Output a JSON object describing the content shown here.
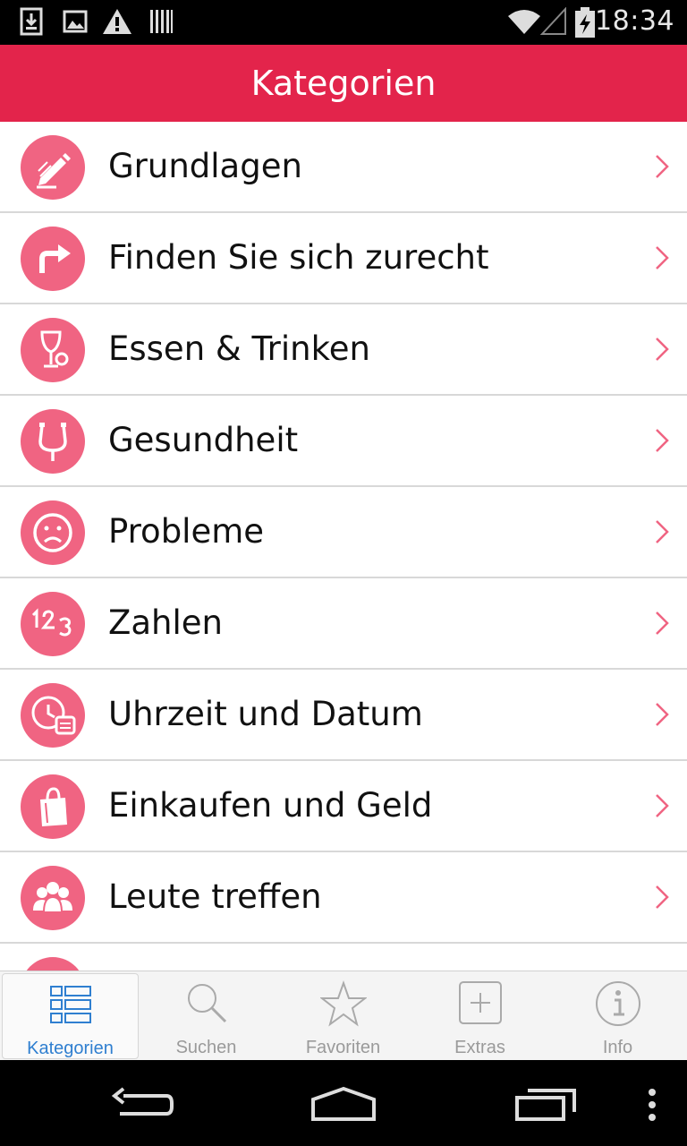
{
  "status_bar": {
    "time": "18:34",
    "icons": [
      "download-icon",
      "image-icon",
      "warning-icon",
      "barcode-icon",
      "wifi-icon",
      "signal-icon",
      "battery-charging-icon"
    ]
  },
  "header": {
    "title": "Kategorien"
  },
  "categories": [
    {
      "label": "Grundlagen",
      "icon": "pencil-icon"
    },
    {
      "label": "Finden Sie sich zurecht",
      "icon": "turn-right-arrow-icon"
    },
    {
      "label": "Essen & Trinken",
      "icon": "wine-glass-icon"
    },
    {
      "label": "Gesundheit",
      "icon": "stethoscope-icon"
    },
    {
      "label": "Probleme",
      "icon": "sad-face-icon"
    },
    {
      "label": "Zahlen",
      "icon": "numbers-icon"
    },
    {
      "label": "Uhrzeit und Datum",
      "icon": "clock-calendar-icon"
    },
    {
      "label": "Einkaufen und Geld",
      "icon": "shopping-bag-icon"
    },
    {
      "label": "Leute treffen",
      "icon": "people-icon"
    }
  ],
  "tabs": [
    {
      "label": "Kategorien",
      "icon": "list-icon",
      "active": true
    },
    {
      "label": "Suchen",
      "icon": "search-icon",
      "active": false
    },
    {
      "label": "Favoriten",
      "icon": "star-icon",
      "active": false
    },
    {
      "label": "Extras",
      "icon": "plus-box-icon",
      "active": false
    },
    {
      "label": "Info",
      "icon": "info-icon",
      "active": false
    }
  ],
  "colors": {
    "accent": "#e3244b",
    "icon_badge": "#f06482",
    "chevron": "#f06482",
    "active_tab": "#2f7fd0",
    "inactive_tab": "#9a9a9a"
  }
}
